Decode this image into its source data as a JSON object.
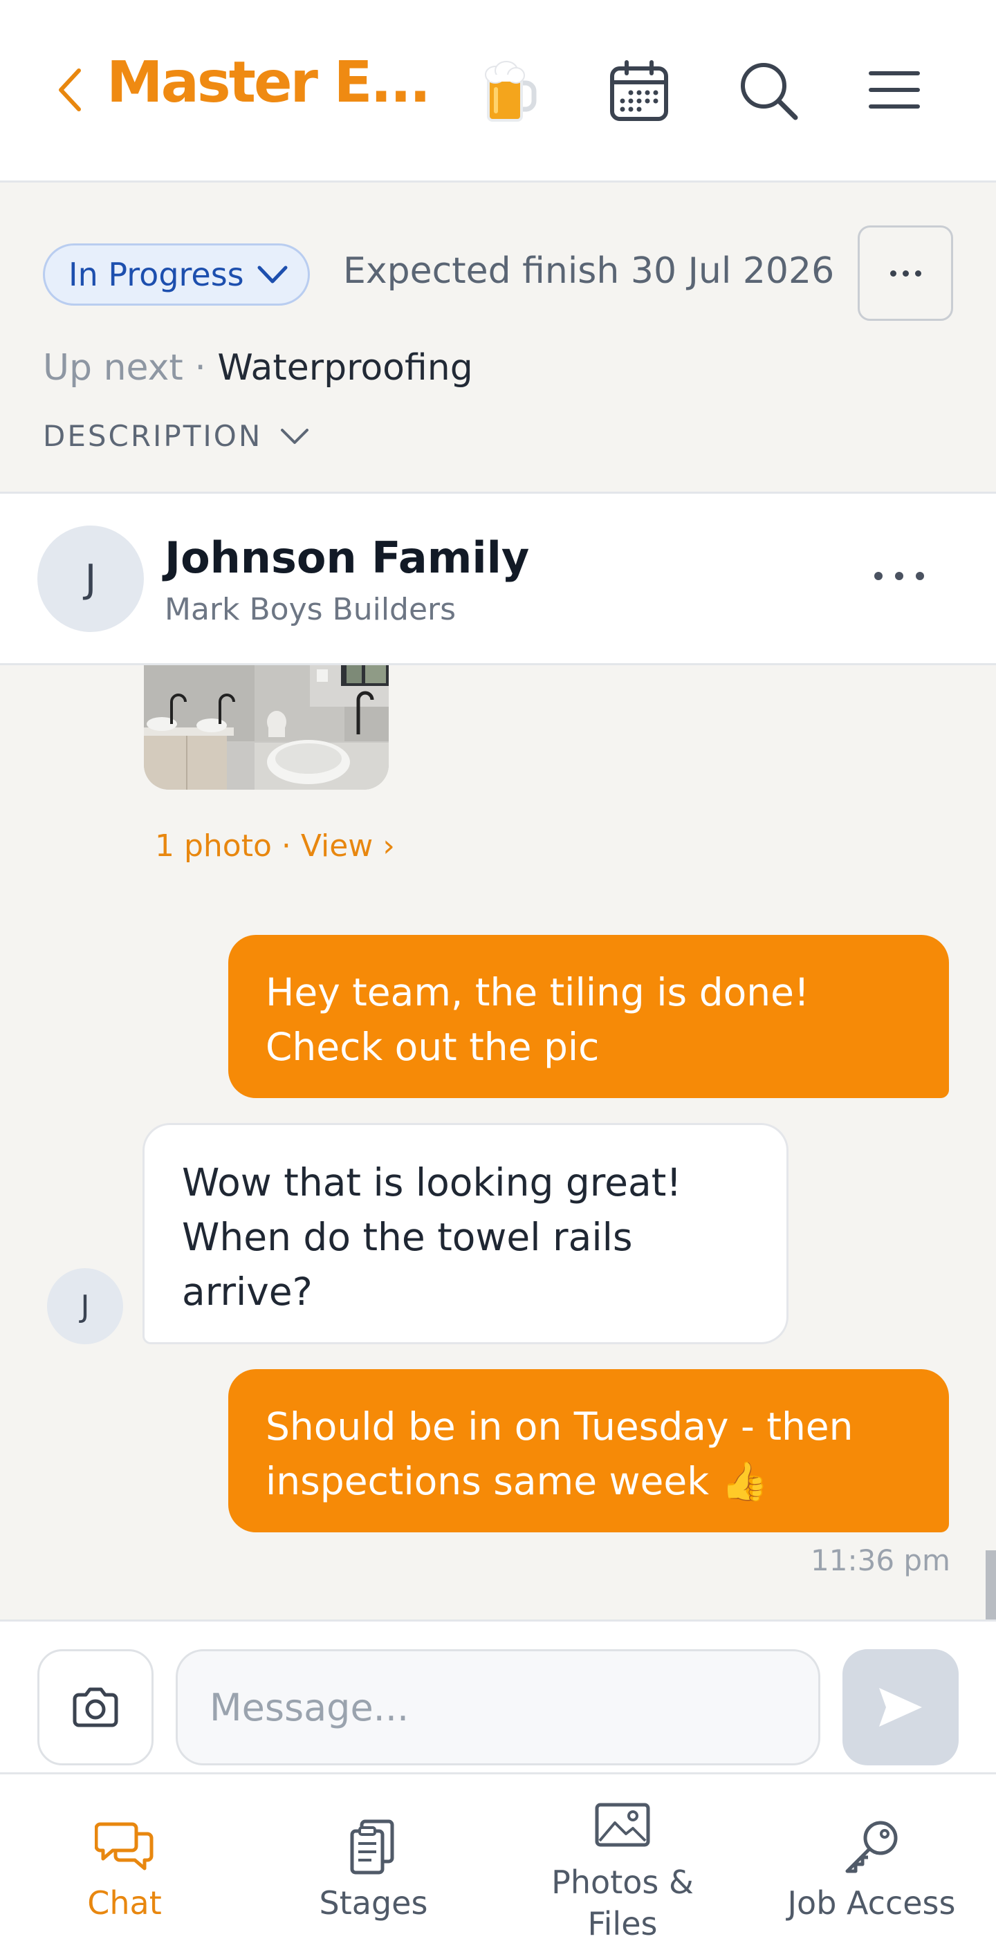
{
  "header": {
    "title": "Master E...",
    "icons": [
      "back-icon",
      "beer-icon",
      "calendar-icon",
      "search-icon",
      "menu-icon"
    ]
  },
  "status": {
    "pill_label": "In Progress",
    "expected_finish": "Expected finish 30 Jul 2026",
    "up_next_label": "Up next",
    "up_next_separator": " · ",
    "up_next_value": "Waterproofing",
    "description_label": "DESCRIPTION"
  },
  "conversation": {
    "avatar_initial": "J",
    "name": "Johnson Family",
    "company": "Mark Boys Builders"
  },
  "messages": {
    "photo_caption": "1 photo · View ›",
    "items": [
      {
        "direction": "outgoing",
        "text": "Hey team, the tiling is done! Check out the pic"
      },
      {
        "direction": "incoming",
        "avatar_initial": "J",
        "text": "Wow that is looking great! When do the towel rails arrive?"
      },
      {
        "direction": "outgoing",
        "text": "Should be in on Tuesday - then inspections same week 👍"
      }
    ],
    "timestamp": "11:36 pm"
  },
  "composer": {
    "placeholder": "Message...",
    "value": ""
  },
  "nav": {
    "items": [
      {
        "label": "Chat",
        "icon": "chat-icon",
        "active": true
      },
      {
        "label": "Stages",
        "icon": "clipboard-icon",
        "active": false
      },
      {
        "label": "Photos & Files",
        "label_line1": "Photos &",
        "label_line2": "Files",
        "icon": "image-icon",
        "active": false
      },
      {
        "label": "Job Access",
        "icon": "key-icon",
        "active": false
      }
    ]
  },
  "colors": {
    "brand_orange": "#f68a07",
    "status_blue": "#1d4fae",
    "panel_bg": "#f5f4f1"
  }
}
